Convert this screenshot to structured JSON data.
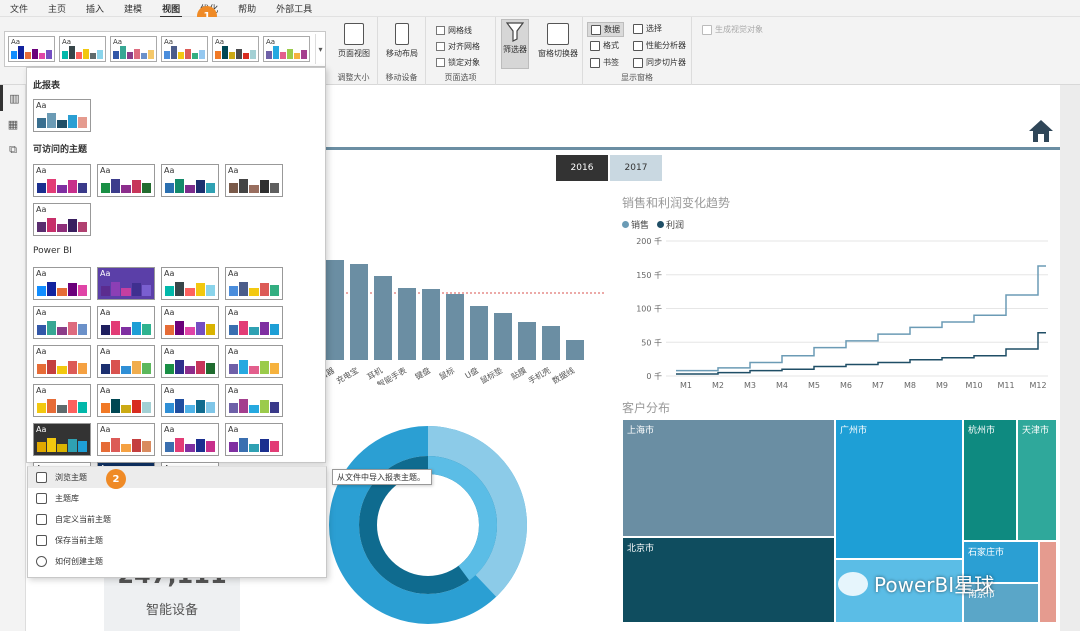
{
  "menu": [
    "文件",
    "主页",
    "插入",
    "建模",
    "视图",
    "优化",
    "帮助",
    "外部工具"
  ],
  "active_menu": "视图",
  "ribbon": {
    "page_view": "页面视图",
    "mobile_layout": "移动布局",
    "group_size": "调整大小",
    "group_mobile": "移动设备",
    "gridlines": "网格线",
    "snap_grid": "对齐网格",
    "lock_objects": "锁定对象",
    "group_page_options": "页面选项",
    "filter_pane": "筛选器",
    "pane_switcher": "窗格切换器",
    "data": "数据",
    "format": "格式",
    "bookmarks": "书签",
    "selection": "选择",
    "performance": "性能分析器",
    "sync_slicers": "同步切片器",
    "group_show_panes": "显示窗格",
    "generate_visual": "生成视觉对象"
  },
  "theme_dropdown": {
    "section_this_report": "此报表",
    "section_accessible": "可访问的主题",
    "section_powerbi": "Power BI",
    "menu_items": [
      "浏览主题",
      "主题库",
      "自定义当前主题",
      "保存当前主题",
      "如何创建主题"
    ],
    "tooltip": "从文件中导入报表主题。"
  },
  "badges": [
    "1",
    "2"
  ],
  "report": {
    "years": [
      "2016",
      "2017"
    ],
    "line_title": "销售和利润变化趋势",
    "legend": [
      "销售",
      "利润"
    ],
    "treemap_title": "客户分布",
    "kpi_value": "247,111",
    "kpi_label": "智能设备",
    "watermark": "PowerBI星球"
  },
  "colors": {
    "sales": "#6b9bb5",
    "profit": "#1f4e66",
    "bar": "#6b8ea3",
    "accent_badge": "#ef8a26"
  },
  "bar_chart": {
    "type": "bar",
    "categories": [
      "路由器",
      "充电宝",
      "耳机",
      "智能手表",
      "键盘",
      "鼠标",
      "U盘",
      "鼠标垫",
      "贴膜",
      "手机壳",
      "数据线"
    ],
    "visible_labels": [
      "路由器",
      "充电宝",
      "耳机",
      "智能手表",
      "键盘",
      "鼠标",
      "U盘",
      "鼠标垫",
      "贴膜",
      "手机壳",
      "数据线"
    ],
    "values": [
      100,
      96,
      84,
      72,
      71,
      66,
      54,
      47,
      38,
      34,
      20
    ],
    "reference_line": 67
  },
  "chart_data": {
    "type": "line",
    "title": "销售和利润变化趋势",
    "x": [
      "M1",
      "M2",
      "M3",
      "M4",
      "M5",
      "M6",
      "M7",
      "M8",
      "M9",
      "M10",
      "M11",
      "M12"
    ],
    "yticks": [
      "0 千",
      "50 千",
      "100 千",
      "150 千",
      "200 千"
    ],
    "ylim": [
      0,
      200
    ],
    "series": [
      {
        "name": "销售",
        "values": [
          8,
          12,
          20,
          30,
          42,
          52,
          62,
          72,
          80,
          90,
          120,
          163
        ]
      },
      {
        "name": "利润",
        "values": [
          3,
          5,
          8,
          10,
          14,
          17,
          20,
          24,
          27,
          30,
          40,
          64
        ]
      }
    ],
    "legend": "top-left",
    "grid": true
  },
  "treemap": [
    {
      "label": "上海市",
      "color": "#6a8ea3"
    },
    {
      "label": "广州市",
      "color": "#1e9fd6"
    },
    {
      "label": "杭州市",
      "color": "#0e8a80"
    },
    {
      "label": "天津市",
      "color": "#2fa89b"
    },
    {
      "label": "北京市",
      "color": "#0f4d5f"
    },
    {
      "label": "石家庄市",
      "color": "#2b9fd3"
    },
    {
      "label": "南京市",
      "color": "#5aa6c8"
    }
  ]
}
